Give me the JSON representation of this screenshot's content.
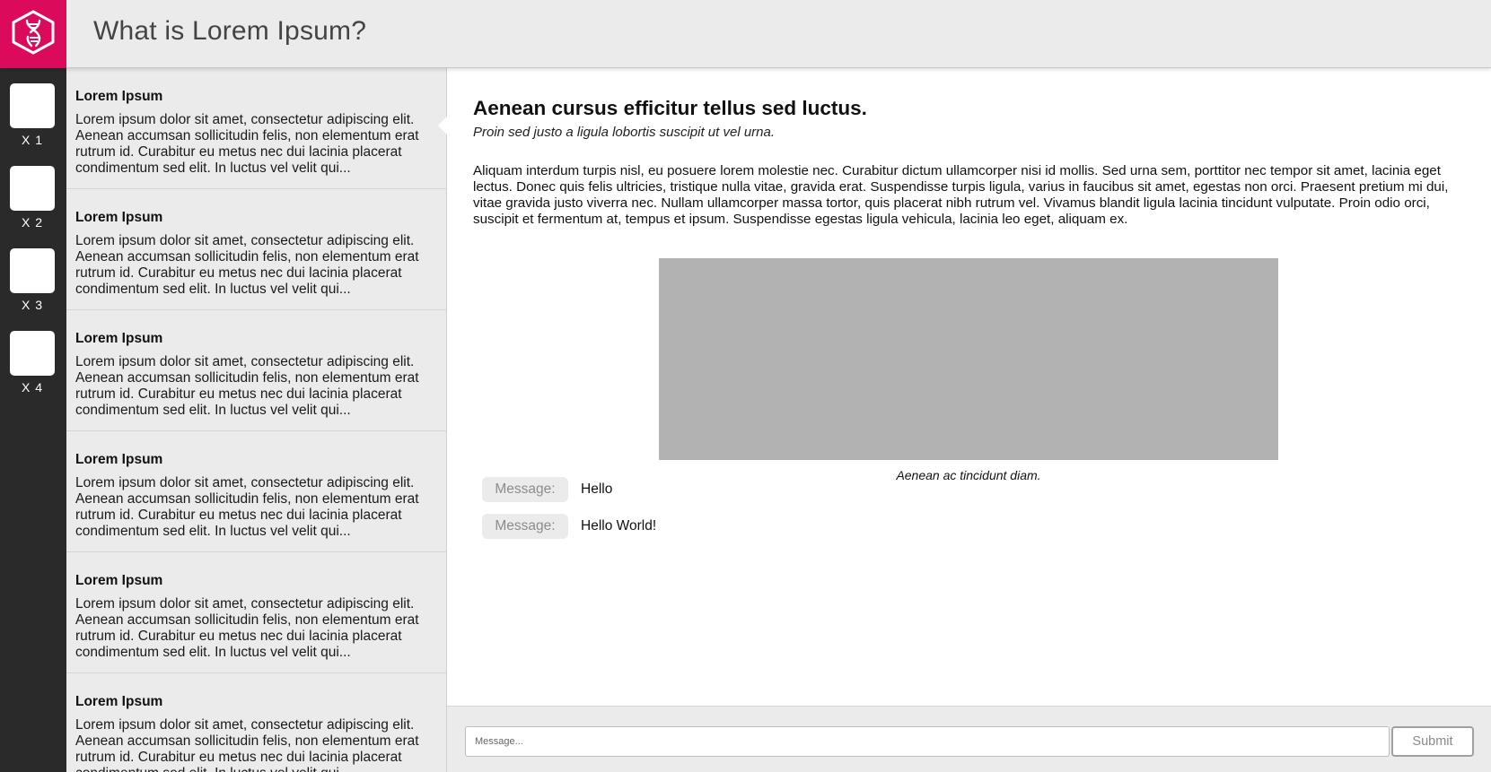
{
  "header": {
    "title": "What is Lorem Ipsum?",
    "logo_icon": "dna-hexagon-logo-icon",
    "brand_color": "#dc0a5a"
  },
  "rail": {
    "items": [
      {
        "label": "X 1"
      },
      {
        "label": "X 2"
      },
      {
        "label": "X 3"
      },
      {
        "label": "X 4"
      }
    ]
  },
  "list": {
    "items": [
      {
        "title": "Lorem Ipsum",
        "excerpt": "Lorem ipsum dolor sit amet, consectetur adipiscing elit. Aenean accumsan sollicitudin felis, non elementum erat rutrum id. Curabitur eu metus nec dui lacinia placerat condimentum sed elit. In luctus vel velit qui..."
      },
      {
        "title": "Lorem Ipsum",
        "excerpt": "Lorem ipsum dolor sit amet, consectetur adipiscing elit. Aenean accumsan sollicitudin felis, non elementum erat rutrum id. Curabitur eu metus nec dui lacinia placerat condimentum sed elit. In luctus vel velit qui..."
      },
      {
        "title": "Lorem Ipsum",
        "excerpt": "Lorem ipsum dolor sit amet, consectetur adipiscing elit. Aenean accumsan sollicitudin felis, non elementum erat rutrum id. Curabitur eu metus nec dui lacinia placerat condimentum sed elit. In luctus vel velit qui..."
      },
      {
        "title": "Lorem Ipsum",
        "excerpt": "Lorem ipsum dolor sit amet, consectetur adipiscing elit. Aenean accumsan sollicitudin felis, non elementum erat rutrum id. Curabitur eu metus nec dui lacinia placerat condimentum sed elit. In luctus vel velit qui..."
      },
      {
        "title": "Lorem Ipsum",
        "excerpt": "Lorem ipsum dolor sit amet, consectetur adipiscing elit. Aenean accumsan sollicitudin felis, non elementum erat rutrum id. Curabitur eu metus nec dui lacinia placerat condimentum sed elit. In luctus vel velit qui..."
      },
      {
        "title": "Lorem Ipsum",
        "excerpt": "Lorem ipsum dolor sit amet, consectetur adipiscing elit. Aenean accumsan sollicitudin felis, non elementum erat rutrum id. Curabitur eu metus nec dui lacinia placerat condimentum sed elit. In luctus vel velit qui..."
      }
    ]
  },
  "article": {
    "title": "Aenean cursus efficitur tellus sed luctus.",
    "subtitle": "Proin sed justo a ligula lobortis suscipit ut vel urna.",
    "body": "Aliquam interdum turpis nisl, eu posuere lorem molestie nec. Curabitur dictum ullamcorper nisi id mollis. Sed urna sem, porttitor nec tempor sit amet, lacinia eget lectus. Donec quis felis ultricies, tristique nulla vitae, gravida erat. Suspendisse turpis ligula, varius in faucibus sit amet, egestas non orci. Praesent pretium mi dui, vitae gravida justo viverra nec. Nullam ullamcorper massa tortor, quis placerat nibh rutrum vel. Vivamus blandit ligula lacinia tincidunt vulputate. Proin odio orci, suscipit et fermentum at, tempus et ipsum. Suspendisse egestas ligula vehicula, lacinia leo eget, aliquam ex.",
    "figure_caption": "Aenean ac tincidunt diam."
  },
  "messages": [
    {
      "label": "Message:",
      "text": "Hello"
    },
    {
      "label": "Message:",
      "text": "Hello World!"
    }
  ],
  "composer": {
    "placeholder": "Message...",
    "value": "",
    "submit_label": "Submit"
  }
}
